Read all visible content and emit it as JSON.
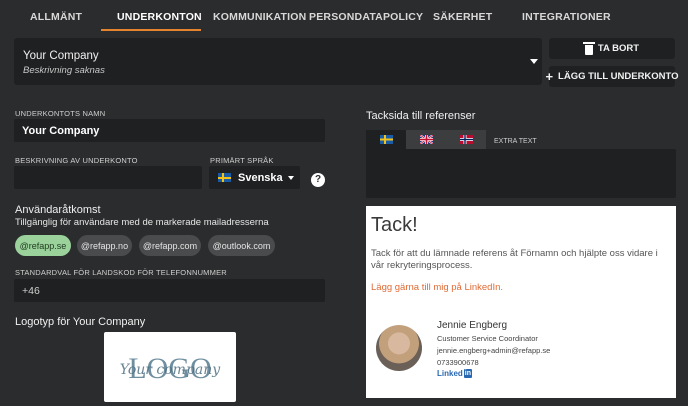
{
  "tabs": [
    {
      "label": "ALLMÄNT"
    },
    {
      "label": "UNDERKONTON"
    },
    {
      "label": "KOMMUNIKATION"
    },
    {
      "label": "PERSONDATAPOLICY"
    },
    {
      "label": "SÄKERHET"
    },
    {
      "label": "INTEGRATIONER"
    }
  ],
  "active_tab": "UNDERKONTON",
  "accent_color": "#e5832f",
  "account_selector": {
    "name": "Your Company",
    "description": "Beskrivning saknas"
  },
  "actions": {
    "delete_label": "TA BORT",
    "add_label": "LÄGG TILL UNDERKONTO"
  },
  "form": {
    "name_label": "UNDERKONTOTS NAMN",
    "name_value": "Your Company",
    "description_label": "BESKRIVNING AV UNDERKONTO",
    "description_value": "",
    "language_label": "PRIMÄRT SPRÅK",
    "language_value": "Svenska",
    "help_glyph": "?"
  },
  "access": {
    "title": "Användaråtkomst",
    "subtitle": "Tillgänglig för användare med de markerade mailadresserna",
    "domains": [
      {
        "label": "@refapp.se",
        "selected": true
      },
      {
        "label": "@refapp.no",
        "selected": false
      },
      {
        "label": "@refapp.com",
        "selected": false
      },
      {
        "label": "@outlook.com",
        "selected": false
      }
    ]
  },
  "phone": {
    "label": "STANDARDVAL FÖR LANDSKOD FÖR TELEFONNUMMER",
    "value": "+46"
  },
  "logo": {
    "title": "Logotyp för Your Company",
    "image_text": "LOGO",
    "script_text": "Your company"
  },
  "thanks_page": {
    "title": "Tacksida till referenser",
    "language_tabs": [
      {
        "flag": "sweden-flag",
        "active": true
      },
      {
        "flag": "uk-flag",
        "active": false
      },
      {
        "flag": "norway-flag",
        "active": false
      }
    ],
    "extra_text_label": "EXTRA TEXT",
    "preview": {
      "heading": "Tack!",
      "body": "Tack för att du lämnade referens åt Förnamn och hjälpte oss vidare i vår rekryteringsprocess.",
      "link_text": "Lägg gärna till mig på LinkedIn.",
      "contact_name": "Jennie Engberg",
      "contact_role": "Customer Service Coordinator",
      "contact_email": "jennie.engberg+admin@refapp.se",
      "contact_phone": "0733900678",
      "linkedin_text": "Linked",
      "linkedin_badge": "in"
    }
  }
}
